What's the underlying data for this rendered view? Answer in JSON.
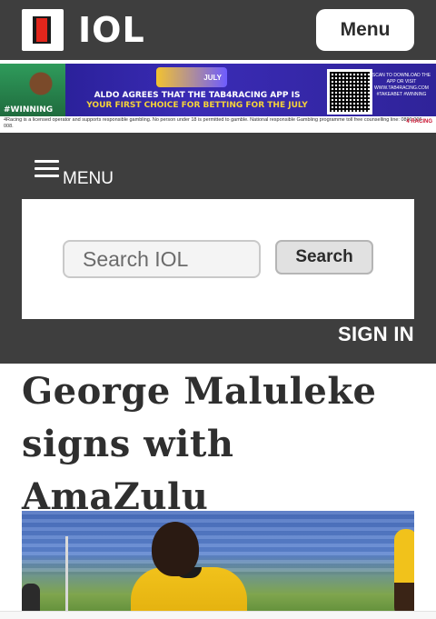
{
  "header": {
    "logo_text": "IOL",
    "menu_button_label": "Menu"
  },
  "ad": {
    "badge_text": "JULY",
    "headline_line1": "ALDO AGREES THAT THE TAB4RACING APP IS",
    "headline_line2": "YOUR FIRST CHOICE FOR BETTING FOR THE JULY",
    "side_tag": "#WINNING",
    "scan_text": "SCAN TO DOWNLOAD THE APP OR VISIT WWW.TAB4RACING.COM #TAKEABET #WINNING",
    "disclaimer": "4Racing is a licensed operator and supports responsible gambling. No person under 18 is permitted to gamble. National responsible Gambling programme toll free counselling line: 0800 006 008.",
    "logos_text": "4 RACING"
  },
  "nav": {
    "menu_label": "MENU",
    "search_placeholder": "Search IOL",
    "search_button_label": "Search",
    "sign_in_label": "SIGN IN"
  },
  "article": {
    "title": "George Maluleke signs with AmaZulu"
  },
  "colors": {
    "header_bg": "#3e3e3e",
    "logo_red": "#e1261c",
    "ad_bg": "#3527a8"
  }
}
